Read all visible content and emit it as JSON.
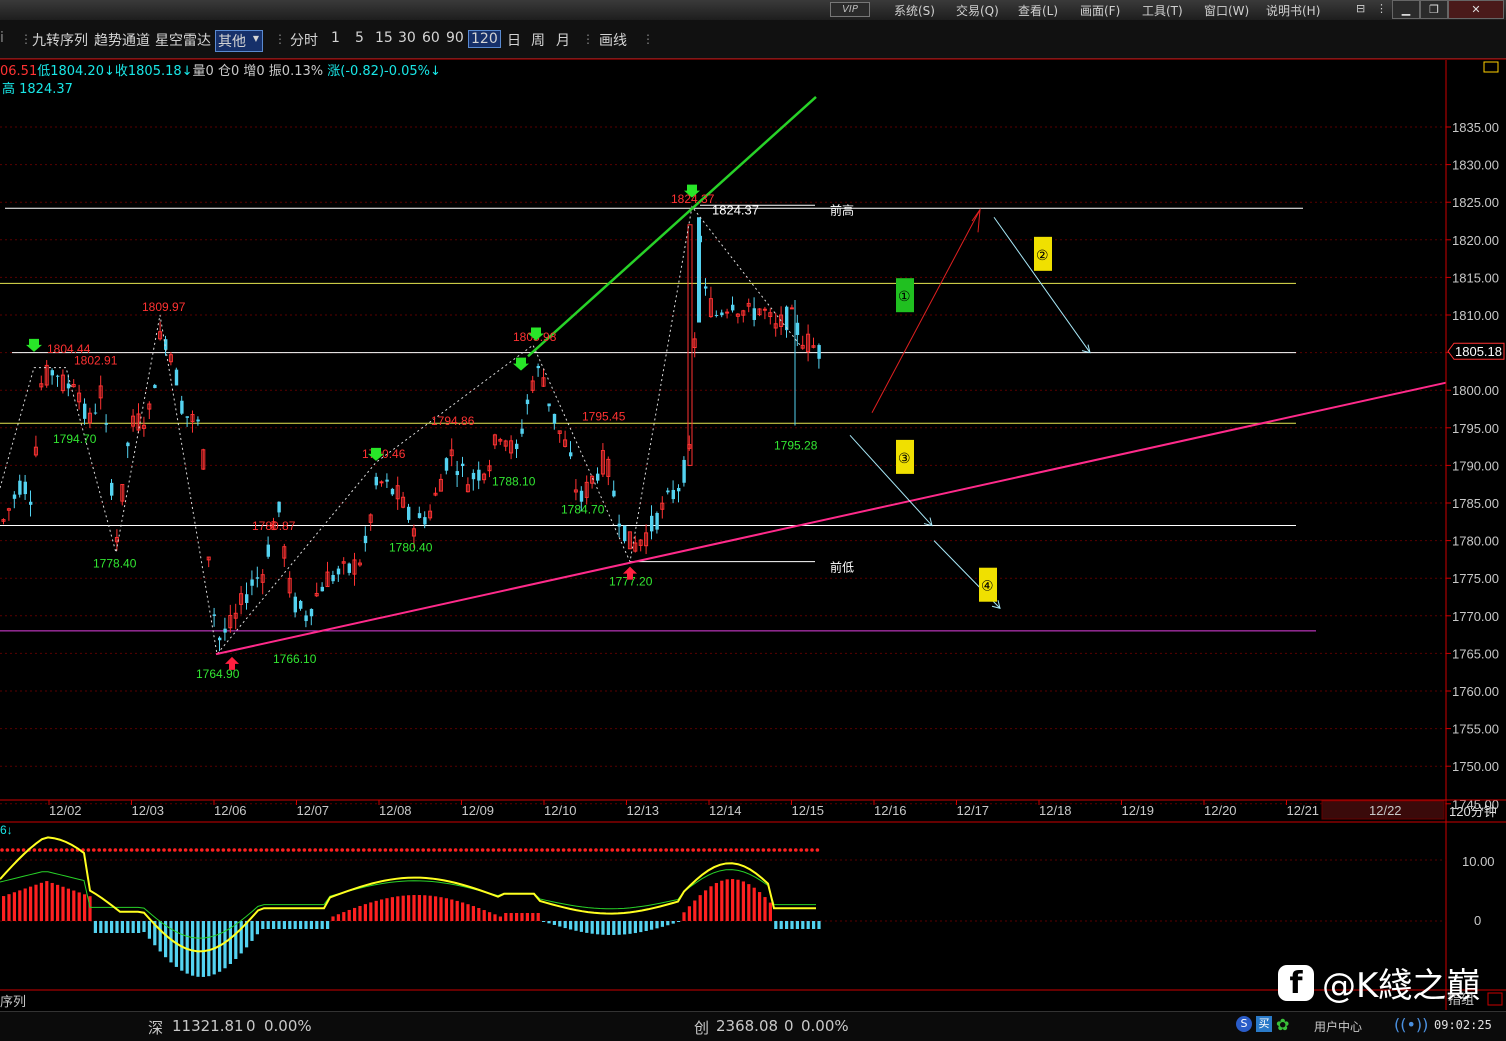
{
  "menubar": {
    "vip_label": "VIP",
    "items": [
      "系统(S)",
      "交易(Q)",
      "查看(L)",
      "画面(F)",
      "工具(T)",
      "窗口(W)",
      "说明书(H)"
    ]
  },
  "toolbar": {
    "left_clip": "i",
    "indicators": [
      "九转序列",
      "趋势通道",
      "星空雷达"
    ],
    "other_select": "其他",
    "timeframes": [
      "分时",
      "1",
      "5",
      "15",
      "30",
      "60",
      "90",
      "120",
      "日",
      "周",
      "月"
    ],
    "active_timeframe": "120",
    "draw_label": "画线"
  },
  "info_line": {
    "open_clip": "06.51",
    "low": "低1804.20↓",
    "close": "收1805.18↓",
    "volume": "量0",
    "position": "仓0",
    "increase": "增0",
    "amplitude": "振0.13%",
    "change": "涨(-0.82)-0.05%↓"
  },
  "high_line": "高 1824.37",
  "chart_data": {
    "type": "candlestick",
    "price_axis": {
      "ticks": [
        "1835.00",
        "1830.00",
        "1825.00",
        "1820.00",
        "1815.00",
        "1810.00",
        "1805.00",
        "1800.00",
        "1795.00",
        "1790.00",
        "1785.00",
        "1780.00",
        "1775.00",
        "1770.00",
        "1765.00",
        "1760.00",
        "1755.00",
        "1750.00",
        "1745.00"
      ],
      "current_price": "1805.18"
    },
    "date_axis": [
      "12/02",
      "12/03",
      "12/06",
      "12/07",
      "12/08",
      "12/09",
      "12/10",
      "12/13",
      "12/14",
      "12/15",
      "12/16",
      "12/17",
      "12/18",
      "12/19",
      "12/20",
      "12/21",
      "12/22"
    ],
    "period_label": "120分钟",
    "red_price_labels": [
      {
        "text": "1804.44",
        "price": 1804.44
      },
      {
        "text": "1802.91",
        "price": 1802.91
      },
      {
        "text": "1809.97",
        "price": 1809.97
      },
      {
        "text": "1780.87",
        "price": 1780.87
      },
      {
        "text": "1790.46",
        "price": 1790.46
      },
      {
        "text": "1794.86",
        "price": 1794.86
      },
      {
        "text": "1805.98",
        "price": 1805.98
      },
      {
        "text": "1795.45",
        "price": 1795.45
      },
      {
        "text": "1824.37",
        "price": 1824.37
      }
    ],
    "green_price_labels": [
      {
        "text": "1794.70",
        "price": 1794.7
      },
      {
        "text": "1778.40",
        "price": 1778.4
      },
      {
        "text": "1764.90",
        "price": 1764.9
      },
      {
        "text": "1766.10",
        "price": 1766.1
      },
      {
        "text": "1780.40",
        "price": 1780.4
      },
      {
        "text": "1788.10",
        "price": 1788.1
      },
      {
        "text": "1784.70",
        "price": 1784.7
      },
      {
        "text": "1777.20",
        "price": 1777.2
      },
      {
        "text": "1795.28",
        "price": 1795.28
      }
    ],
    "annotations": {
      "high_value": "1824.37",
      "prev_high": "前高",
      "prev_low": "前低",
      "circles": [
        "①",
        "②",
        "③",
        "④"
      ]
    },
    "horizontal_levels": [
      1824.2,
      1814.2,
      1805.0,
      1795.6,
      1782.0,
      1777.2,
      1768.0
    ],
    "macd": {
      "label": "6↓",
      "ticks": [
        "10.00",
        "0"
      ]
    }
  },
  "bottom_tab": "序列",
  "status": {
    "sz_label": "深",
    "sz_value": "11321.81",
    "sz_change": "0",
    "sz_pct": "0.00%",
    "cy_label": "创",
    "cy_value": "2368.08",
    "cy_change": "0",
    "cy_pct": "0.00%",
    "user_center": "用户中心",
    "time": "09:02:25",
    "nav_label": "指组"
  },
  "watermark": "@K綫之巔",
  "colors": {
    "up": "#ff3232",
    "down": "#54d2f0",
    "green_label": "#32e632",
    "magenta": "#ff2a8a",
    "yellow": "#ffff00"
  }
}
